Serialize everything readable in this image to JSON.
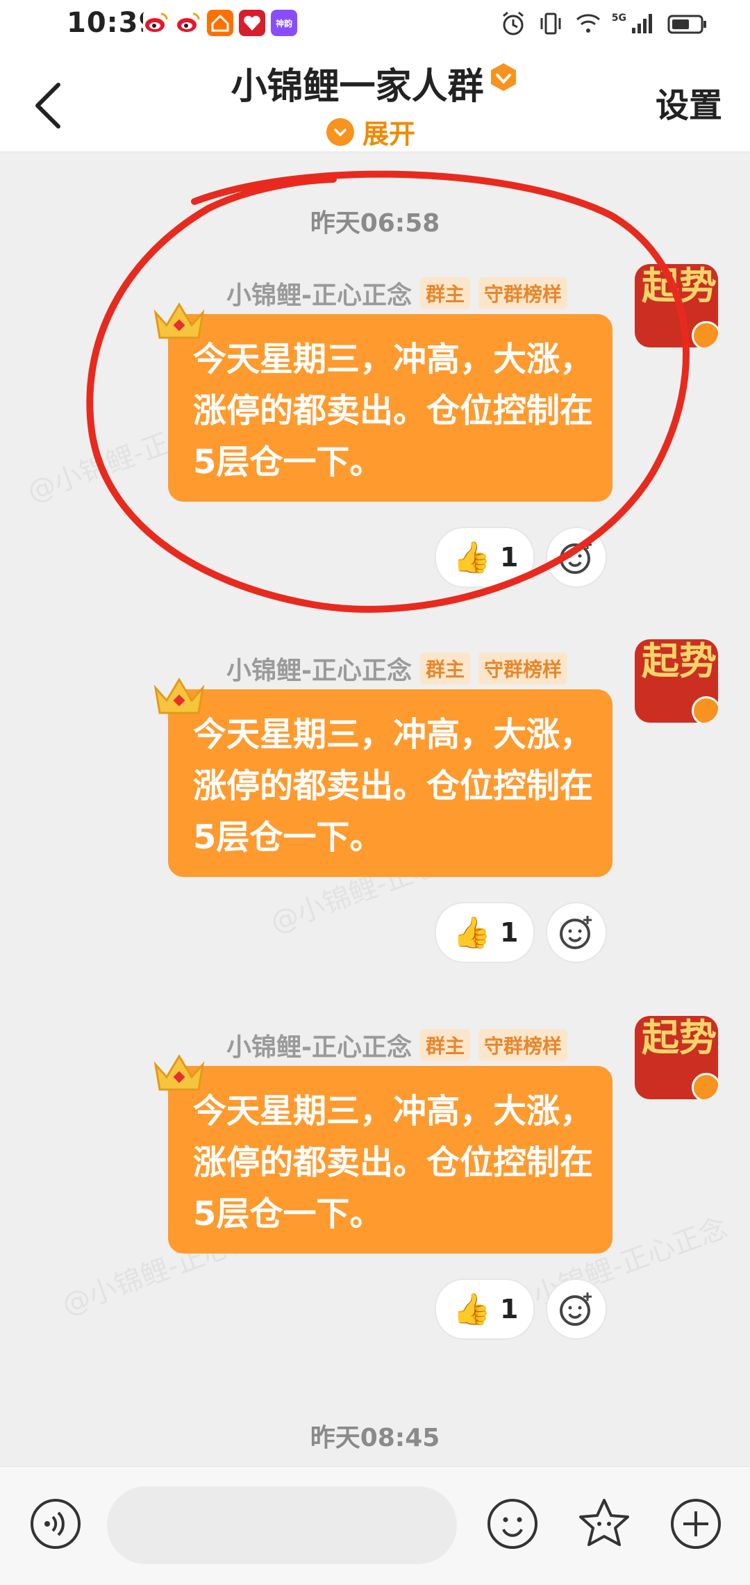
{
  "status_bar": {
    "time": "10:39",
    "apps": [
      {
        "icon": "weibo-icon",
        "color": "#e6162d",
        "label": ""
      },
      {
        "icon": "weibo-icon",
        "color": "#e6162d",
        "label": ""
      },
      {
        "icon": "home-app-icon",
        "color": "#ff6f00",
        "label": ""
      },
      {
        "icon": "heart-app-icon",
        "color": "#d81e2c",
        "label": ""
      },
      {
        "icon": "shenjing-icon",
        "color": "#8a4cff",
        "label": "神韵"
      }
    ],
    "network": "5G"
  },
  "header": {
    "title": "小锦鲤一家人群",
    "expand_label": "展开",
    "settings_label": "设置"
  },
  "timestamps": [
    "昨天06:58",
    "昨天08:45"
  ],
  "messages": [
    {
      "sender": "小锦鲤-正心正念",
      "tags": [
        "群主",
        "守群榜样"
      ],
      "text": "今天星期三，冲高，大涨，涨停的都卖出。仓位控制在5层仓一下。",
      "reaction": {
        "emoji": "👍",
        "count": "1"
      },
      "avatar_text": "起势"
    },
    {
      "sender": "小锦鲤-正心正念",
      "tags": [
        "群主",
        "守群榜样"
      ],
      "text": "今天星期三，冲高，大涨，涨停的都卖出。仓位控制在5层仓一下。",
      "reaction": {
        "emoji": "👍",
        "count": "1"
      },
      "avatar_text": "起势"
    },
    {
      "sender": "小锦鲤-正心正念",
      "tags": [
        "群主",
        "守群榜样"
      ],
      "text": "今天星期三，冲高，大涨，涨停的都卖出。仓位控制在5层仓一下。",
      "reaction": {
        "emoji": "👍",
        "count": "1"
      },
      "avatar_text": "起势"
    }
  ],
  "watermark": "@小锦鲤-正心正念",
  "colors": {
    "bubble": "#ff9a2e",
    "accent": "#f08a00",
    "annotation": "#e82a1e",
    "background": "#efefef"
  }
}
